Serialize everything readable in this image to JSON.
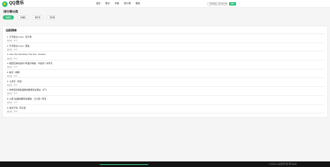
{
  "brand": {
    "logo_text": "QQ音乐"
  },
  "nav": {
    "items": [
      "首页",
      "歌手",
      "专辑",
      "排行榜",
      "歌单"
    ]
  },
  "search": {
    "placeholder": "搜索歌曲、歌手或专辑",
    "button_label": "搜索"
  },
  "page": {
    "title": "排行榜分类"
  },
  "tabs": [
    {
      "label": "热歌榜",
      "active": true
    },
    {
      "label": "新歌榜",
      "active": false
    },
    {
      "label": "飙升榜",
      "active": false
    },
    {
      "label": "原创榜",
      "active": false
    }
  ],
  "chart": {
    "title": "当前榜单",
    "items": [
      {
        "title": "1. 不可思议 (Live) - 毛不易",
        "meta": "播放量：3475"
      },
      {
        "title": "2. 不可思议 (Live) - 若谷",
        "meta": "播放量：3475"
      },
      {
        "title": "3. Over The SunriOver The Sun - Firstone",
        "meta": "播放量：3475"
      },
      {
        "title": "4. 把回忆拼好给你 (粤语示例版) - 华晨宇 / 刘可可",
        "meta": "播放量：3475"
      },
      {
        "title": "5. 晴天 - 杨苒",
        "meta": "播放量：3475"
      },
      {
        "title": "6. 七月天 - 周深",
        "meta": "播放量：3475"
      },
      {
        "title": "7. 你曾经对我说温柔的旋律还在耳边 - 许飞",
        "meta": "播放量：3475"
      },
      {
        "title": "8. 心愿 (最美的期待演唱版) - 王力宏 / 周深",
        "meta": "播放量：3475"
      },
      {
        "title": "9. 春天不停 - 周子瑶",
        "meta": "播放量：3475"
      }
    ]
  },
  "footer": {
    "watermark": "CSDN @软件技术NINI"
  },
  "colors": {
    "accent": "#31c27c",
    "bottom_bar": "#141414"
  }
}
